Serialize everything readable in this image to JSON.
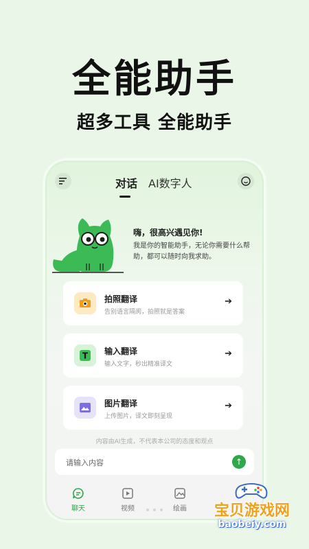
{
  "promo": {
    "headline": "全能助手",
    "subheadline": "超多工具 全能助手"
  },
  "app": {
    "tabs": [
      {
        "label": "对话",
        "active": true
      },
      {
        "label": "AI数字人",
        "active": false
      }
    ],
    "greeting": {
      "title": "嗨，很高兴遇见你!",
      "body": "我是你的智能助手，无论你需要什么帮助，都可以随时向我求助。"
    },
    "features": [
      {
        "title": "拍照翻译",
        "subtitle": "告别语言隔阂，拍照就是答案",
        "icon": "camera-icon",
        "icon_bg": "#fde9c2"
      },
      {
        "title": "输入翻译",
        "subtitle": "输入文字，秒出精准译文",
        "icon": "text-icon",
        "icon_bg": "#d8f3d9"
      },
      {
        "title": "图片翻译",
        "subtitle": "上传图片，译文即刻呈现",
        "icon": "image-icon",
        "icon_bg": "#e6e3f8"
      }
    ],
    "disclaimer": "内容由AI生成，不代表本公司的态度和观点",
    "input": {
      "placeholder": "请输入内容",
      "value": ""
    },
    "nav": [
      {
        "label": "聊天",
        "icon": "chat-icon",
        "active": true
      },
      {
        "label": "视频",
        "icon": "video-icon",
        "active": false
      },
      {
        "label": "绘画",
        "icon": "picture-icon",
        "active": false
      }
    ],
    "accent_color": "#2fa74a"
  },
  "watermark": {
    "title": "宝贝游戏网",
    "url": "baobeiy.com"
  }
}
